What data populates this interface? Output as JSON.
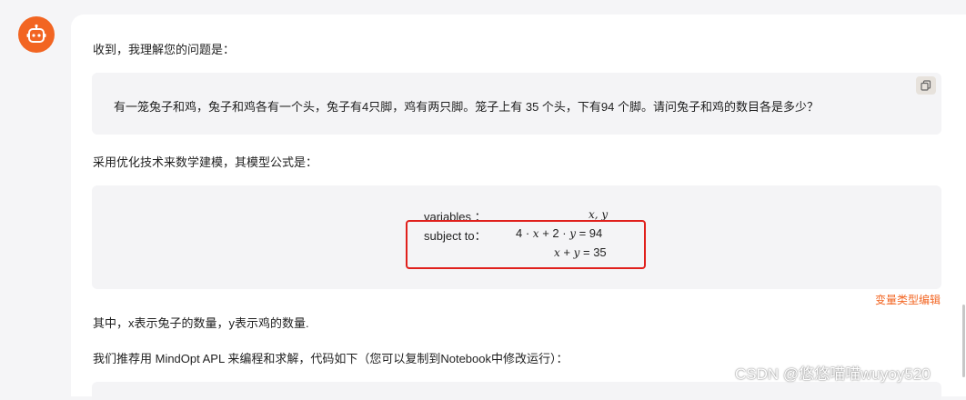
{
  "assistant": {
    "avatar_icon": "robot-icon",
    "accent": "#f26522"
  },
  "message": {
    "intro": "收到，我理解您的问题是：",
    "problem": "有一笼兔子和鸡，兔子和鸡各有一个头，兔子有4只脚，鸡有两只脚。笼子上有 35 个头，下有94 个脚。请问兔子和鸡的数目各是多少？",
    "copy_icon": "copy-icon",
    "model_lead": "采用优化技术来数学建模，其模型公式是：",
    "formula": {
      "variables_label": "variables ：",
      "variables_value": "x, y",
      "subject_label": "subject to：",
      "constraint1_lhs_a": "4 · ",
      "constraint1_lhs_x": "x",
      "constraint1_lhs_b": " + 2 · ",
      "constraint1_lhs_y": "y",
      "constraint1_rhs": " = 94",
      "constraint2_x": "x",
      "constraint2_plus": " + ",
      "constraint2_y": "y",
      "constraint2_rhs": " = 35",
      "highlight_color": "#e0201c"
    },
    "edit_link": "变量类型编辑",
    "explanation": "其中，x表示兔子的数量，y表示鸡的数量.",
    "recommend": "我们推荐用 MindOpt APL 来编程和求解，代码如下（您可以复制到Notebook中修改运行）："
  },
  "watermark": "CSDN @悠悠喵喵wuyoy520"
}
